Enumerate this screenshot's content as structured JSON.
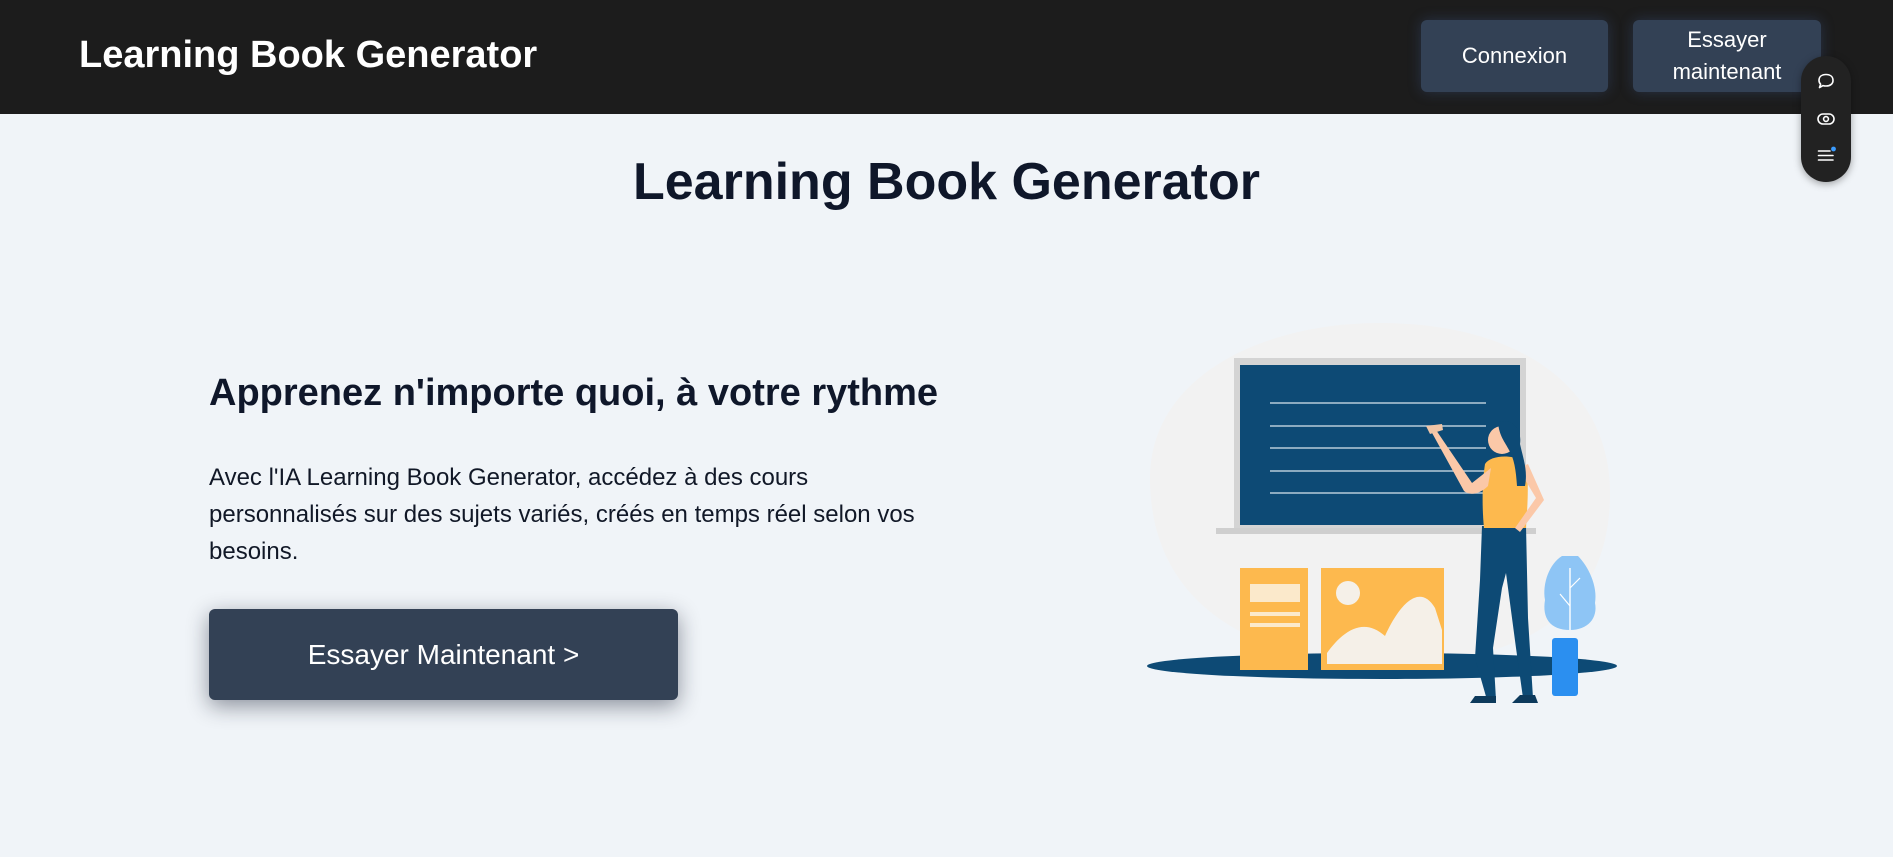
{
  "header": {
    "brand": "Learning Book Generator",
    "login_label": "Connexion",
    "try_label": "Essayer maintenant"
  },
  "widget": {
    "icons": [
      "chat-bubble-icon",
      "eye-icon",
      "menu-list-icon"
    ]
  },
  "main": {
    "title": "Learning Book Generator",
    "hero_heading": "Apprenez n'importe quoi, à votre rythme",
    "hero_text": "Avec l'IA Learning Book Generator, accédez à des cours personnalisés sur des sujets variés, créés en temps réel selon vos besoins.",
    "cta_label": "Essayer Maintenant >"
  },
  "colors": {
    "header_bg": "#1c1c1c",
    "page_bg": "#f0f4f8",
    "button_bg": "#334155",
    "title_text": "#0f172a",
    "board_blue": "#0d4a75",
    "accent_yellow": "#fdb94e",
    "accent_light_blue": "#8ec5f5"
  }
}
